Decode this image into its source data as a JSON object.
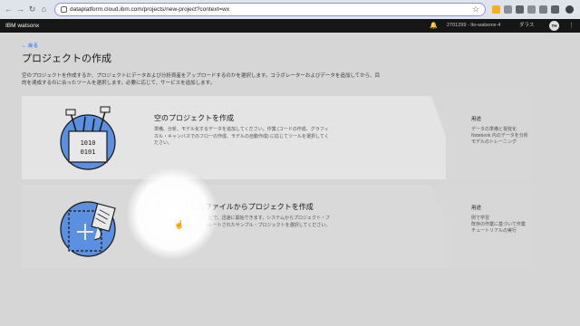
{
  "browser": {
    "url": "dataplatform.cloud.ibm.com/projects/new-project?context=wx",
    "back_icon": "arrow-left-icon",
    "forward_icon": "arrow-right-icon",
    "reload_icon": "reload-icon",
    "home_icon": "home-icon",
    "star_icon": "star-icon"
  },
  "appbar": {
    "brand": "IBM watsonx",
    "account": "2701299 - Ito-watsonx-4",
    "region": "ダラス",
    "avatar_initials": "TH"
  },
  "page": {
    "back_label": "← 戻る",
    "title": "プロジェクトの作成",
    "description": "空のプロジェクトを作成するか、プロジェクトにデータおよび分析資産をアップロードするのかを選択します。コラボレーターおよびデータを追加してから、目的を達成するのに合ったツールを選択します。必要に応じて、サービスを追加します。"
  },
  "cards": [
    {
      "title": "空のプロジェクトを作成",
      "description": "準備、分析、モデル化するデータを追加してください。作業 (コードの作成、グラフィカル・キャンバスでのフローの作成、モデルの自動作成) に応じてツールを選択してください。",
      "uses_label": "用途",
      "uses": [
        "データの準備と視覚化",
        "Notebook 内のデータを分析",
        "モデルのトレーニング"
      ]
    },
    {
      "title": "サンプルまたはファイルからプロジェクトを作成",
      "description": "既存の資産をロードすることで、迅速に開始できます。システムからプロジェクト・ファイルを選択するか、キュレートされたサンプル・プロジェクトを選択してください。",
      "uses_label": "用途",
      "uses": [
        "例で学習",
        "既存の作業に基づいて作業",
        "チュートリアルの実行"
      ]
    }
  ],
  "illustration_text": {
    "line1": "1010",
    "line2": "0101"
  },
  "colors": {
    "accent": "#0f62fe",
    "illus_blue": "#5b8fe0"
  }
}
